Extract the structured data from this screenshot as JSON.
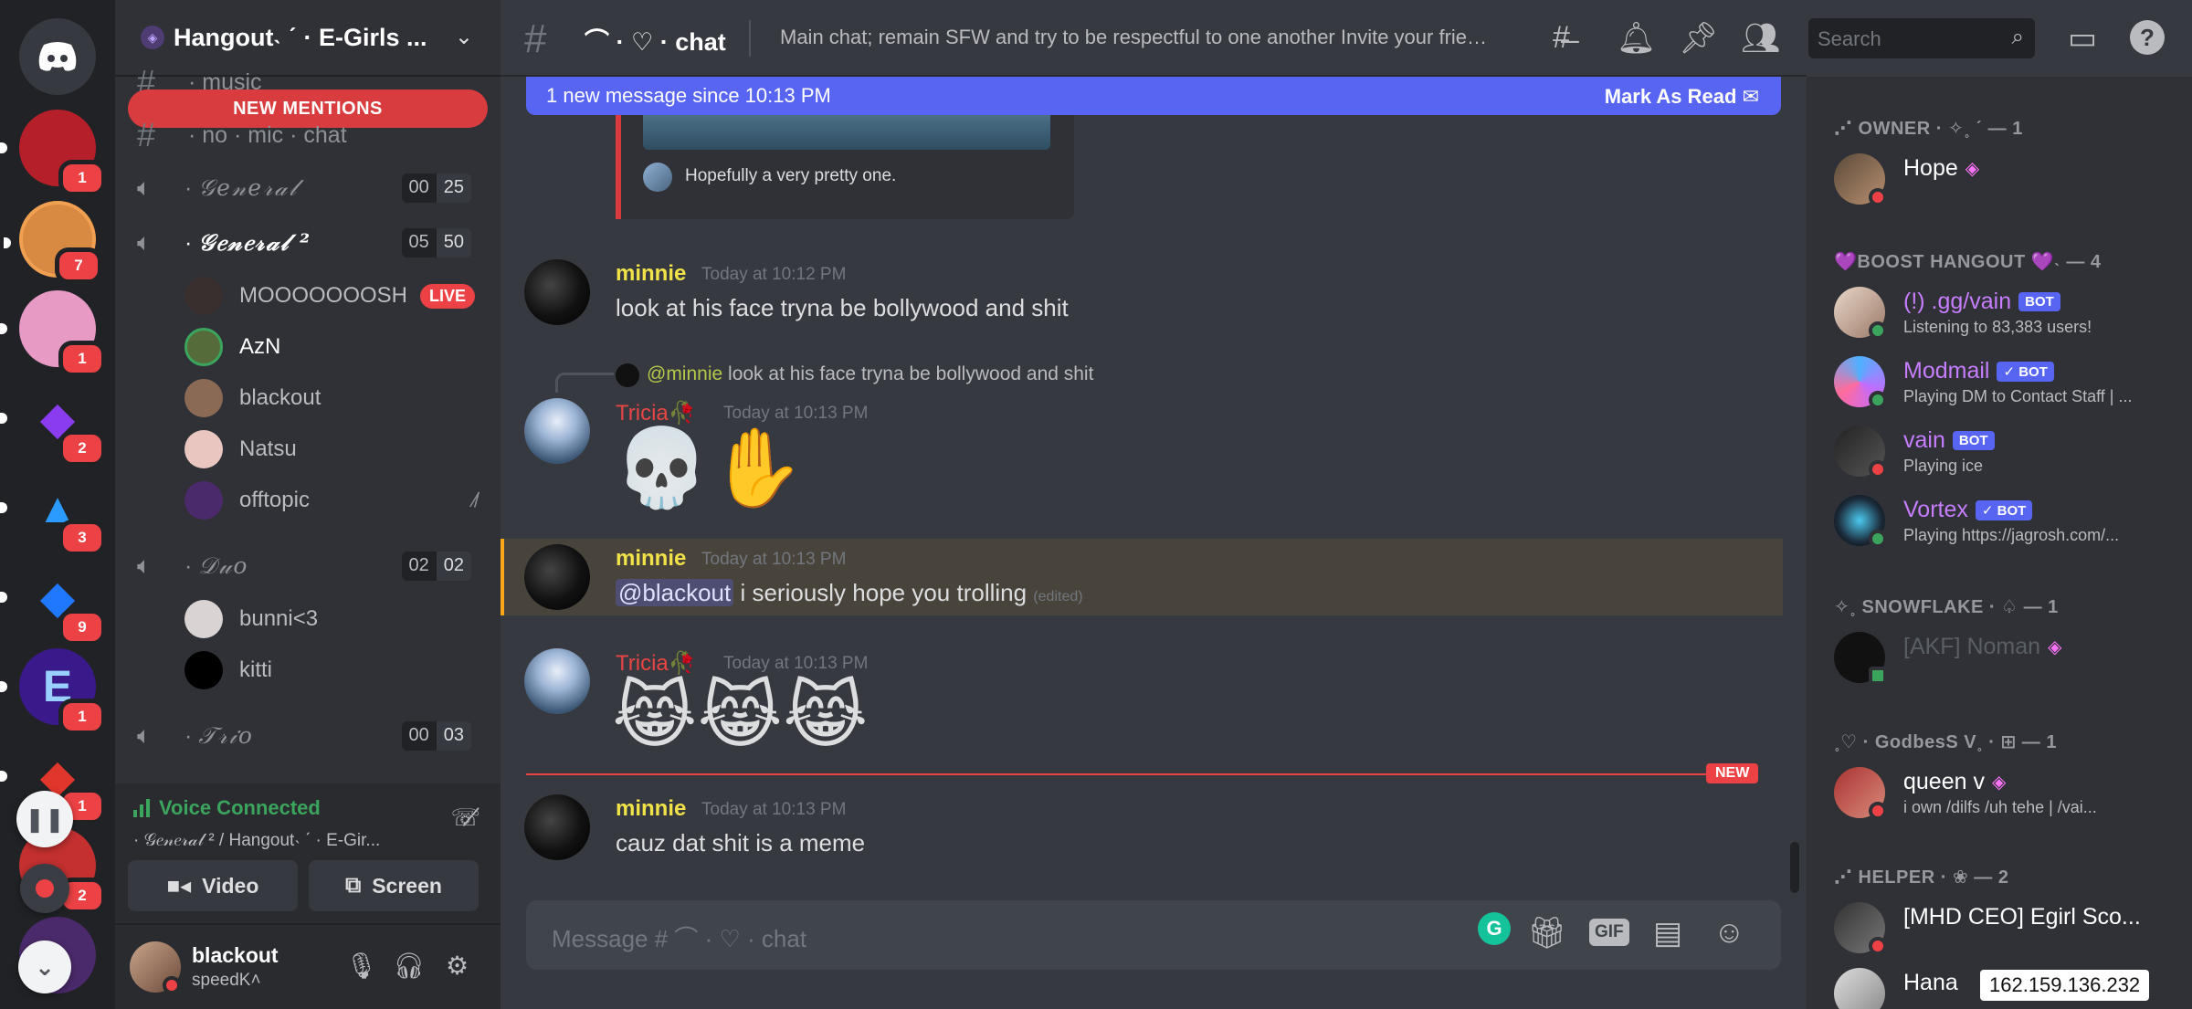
{
  "rail": {
    "servers": [
      {
        "name": "Home",
        "icon": "discord-logo-icon",
        "badge": "",
        "color": "#36393f",
        "glyph": "◉"
      },
      {
        "name": "Server 1",
        "icon": "server-icon",
        "badge": "1",
        "color": "#b51f2a",
        "glyph": ""
      },
      {
        "name": "Server 2",
        "icon": "server-icon",
        "badge": "7",
        "color": "#d98a42",
        "glyph": ""
      },
      {
        "name": "Server 3",
        "icon": "server-icon",
        "badge": "1",
        "color": "#e79ac4",
        "glyph": ""
      },
      {
        "name": "Server 4",
        "icon": "server-icon",
        "badge": "2",
        "color": "#7d3cf0",
        "glyph": "◆"
      },
      {
        "name": "Server 5",
        "icon": "server-icon",
        "badge": "3",
        "color": "#202225",
        "glyph": "▲"
      },
      {
        "name": "Server 6",
        "icon": "server-icon",
        "badge": "9",
        "color": "#1f78ff",
        "glyph": "◆"
      },
      {
        "name": "Server 7",
        "icon": "server-icon",
        "badge": "1",
        "color": "#3a1a8a",
        "glyph": "E"
      },
      {
        "name": "Server 8",
        "icon": "server-icon",
        "badge": "1",
        "color": "#e0362c",
        "glyph": "◆"
      },
      {
        "name": "Server 9",
        "icon": "server-icon",
        "badge": "2",
        "color": "#c43030",
        "glyph": ""
      }
    ]
  },
  "guild": {
    "name": "Hangout˴ ˊ · E-Girls ...",
    "new_mentions": "NEW MENTIONS",
    "channels_top": [
      {
        "type": "text",
        "name": "· music"
      },
      {
        "type": "text",
        "name": "· no · mic · chat"
      }
    ],
    "voice": [
      {
        "name": "𝒢𝑒𝓃𝑒𝓇𝒶𝓁",
        "count_a": "00",
        "count_b": "25",
        "users": []
      },
      {
        "name": "𝒢𝑒𝓃𝑒𝓇𝒶𝓁 ²",
        "count_a": "05",
        "count_b": "50",
        "users": [
          {
            "name": "MOOOOOOOSH",
            "live": "LIVE",
            "color": "#3a2f2f"
          },
          {
            "name": "AzN",
            "live": "",
            "color": "#556b3a"
          },
          {
            "name": "blackout",
            "live": "",
            "color": "#8b6a55"
          },
          {
            "name": "Natsu",
            "live": "",
            "color": "#e9c7c0"
          },
          {
            "name": "offtopic",
            "live": "",
            "color": "#4b2a6b"
          }
        ]
      },
      {
        "name": "𝒟𝓊𝑜",
        "count_a": "02",
        "count_b": "02",
        "users": [
          {
            "name": "bunni<3",
            "live": "",
            "color": "#d9d3d3"
          },
          {
            "name": "kitti",
            "live": "",
            "color": "#000000"
          }
        ]
      },
      {
        "name": "𝒯𝓇𝒾𝑜",
        "count_a": "00",
        "count_b": "03",
        "users": []
      }
    ]
  },
  "voice_panel": {
    "status": "Voice Connected",
    "location": "· 𝒢𝑒𝓃𝑒𝓇𝒶𝓁 ² / Hangout˴ ˊ · E-Gir...",
    "video_label": "Video",
    "screen_label": "Screen"
  },
  "user_panel": {
    "name": "blackout",
    "tag": "speedK˄"
  },
  "chat": {
    "channel_name": "⌒ · ♡ · chat",
    "topic": "Main chat; remain SFW and try to be respectful to one another Invite your frien...",
    "new_bar": "1 new message since 10:13 PM",
    "mark_read": "Mark As Read",
    "embed_caption": "Hopefully a very pretty one.",
    "search_placeholder": "Search",
    "messages": [
      {
        "author": "minnie",
        "time": "Today at 10:12 PM",
        "text": "look at his face tryna be bollywood and shit"
      },
      {
        "reply_author": "@minnie",
        "reply_text": "look at his face tryna be bollywood and shit",
        "author": "Tricia",
        "time": "Today at 10:13 PM",
        "emoji": "💀✋"
      },
      {
        "author": "minnie",
        "time": "Today at 10:13 PM",
        "mention": "@blackout",
        "text": " i seriously hope you trolling",
        "edited": "(edited)"
      },
      {
        "author": "Tricia",
        "time": "Today at 10:13 PM",
        "emoji": "😹😹😹"
      },
      {
        "author": "minnie",
        "time": "Today at 10:13 PM",
        "text": "cauz dat shit is a meme"
      }
    ],
    "new_tag": "NEW",
    "composer_placeholder": "Message # ⌒ · ♡ · chat",
    "gif_label": "GIF",
    "grammarly": "G"
  },
  "members": {
    "categories": [
      {
        "label": "⋰ OWNER · ✧˳ ˊ — 1"
      },
      {
        "label": "💜BOOST HANGOUT 💜˴ — 4"
      },
      {
        "label": "✧˳ SNOWFLAKE · ♤ — 1"
      },
      {
        "label": "˳♡ · GodbesS V˳ · ⊞ — 1"
      },
      {
        "label": "⋰ HELPER · ❀ — 2"
      }
    ],
    "list": [
      {
        "name": "Hope",
        "sub": "",
        "bot": "",
        "color": "#ffffff",
        "status": "#ed4245",
        "boost": "◈"
      },
      {
        "name": "(!) .gg/vain",
        "sub": "Listening to 83,383 users!",
        "bot": "BOT",
        "color": "#c77dff",
        "status": "#3ba55d",
        "boost": ""
      },
      {
        "name": "Modmail",
        "sub": "Playing DM to Contact Staff | ...",
        "bot": "✓ BOT",
        "color": "#c77dff",
        "status": "#3ba55d",
        "boost": ""
      },
      {
        "name": "vain",
        "sub": "Playing ice",
        "bot": "BOT",
        "color": "#c77dff",
        "status": "#ed4245",
        "boost": ""
      },
      {
        "name": "Vortex",
        "sub": "Playing https://jagrosh.com/...",
        "bot": "✓ BOT",
        "color": "#c77dff",
        "status": "#3ba55d",
        "boost": ""
      },
      {
        "name": "[AKF] Noman",
        "sub": "",
        "bot": "",
        "color": "#5a5f66",
        "status": "#3ba55d",
        "boost": "◈"
      },
      {
        "name": "queen v",
        "sub": "i own /dilfs /uh tehe | /vai...",
        "bot": "",
        "color": "#ffffff",
        "status": "#ed4245",
        "boost": "◈"
      },
      {
        "name": "[MHD CEO] Egirl Sco...",
        "sub": "",
        "bot": "",
        "color": "#ffffff",
        "status": "#ed4245",
        "boost": ""
      },
      {
        "name": "Hana",
        "sub": "",
        "bot": "",
        "color": "#ffffff",
        "status": "#ed4245",
        "boost": ""
      }
    ],
    "ip": "162.159.136.232"
  }
}
